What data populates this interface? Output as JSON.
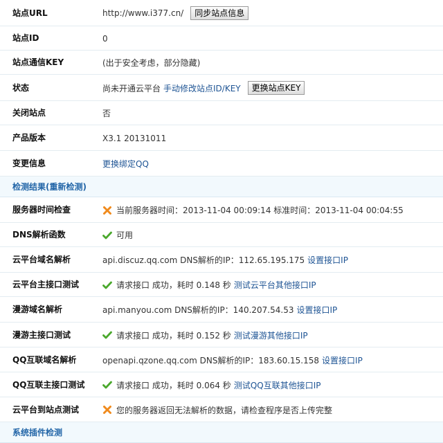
{
  "colors": {
    "link": "#1e5494",
    "section_bg": "#f2f9fd",
    "section_text": "#2366a8",
    "ok": "#4aa82c",
    "err": "#f08a1c"
  },
  "site": {
    "url_label": "站点URL",
    "url_value": "http://www.i377.cn/",
    "url_button": "同步站点信息",
    "id_label": "站点ID",
    "id_value": "0",
    "key_label": "站点通信KEY",
    "key_value": "(出于安全考虑，部分隐藏)",
    "status_label": "状态",
    "status_value": "尚未开通云平台",
    "status_link": "手动修改站点ID/KEY",
    "status_button": "更换站点KEY",
    "close_label": "关闭站点",
    "close_value": "否",
    "version_label": "产品版本",
    "version_value": "X3.1 20131011",
    "change_label": "变更信息",
    "change_link": "更换绑定QQ"
  },
  "check": {
    "section_title": "检测结果(重新检测)",
    "rows": [
      {
        "label": "服务器时间检查",
        "icon": "error-x-icon",
        "text": "当前服务器时间：2013-11-04 00:09:14 标准时间：2013-11-04 00:04:55",
        "link": ""
      },
      {
        "label": "DNS解析函数",
        "icon": "success-check-icon",
        "text": "可用",
        "link": ""
      },
      {
        "label": "云平台域名解析",
        "icon": "",
        "text": "api.discuz.qq.com DNS解析的IP：112.65.195.175",
        "link": "设置接口IP"
      },
      {
        "label": "云平台主接口测试",
        "icon": "success-check-icon",
        "text": "请求接口 成功，耗时 0.148 秒",
        "link": "测试云平台其他接口IP"
      },
      {
        "label": "漫游域名解析",
        "icon": "",
        "text": "api.manyou.com DNS解析的IP：140.207.54.53",
        "link": "设置接口IP"
      },
      {
        "label": "漫游主接口测试",
        "icon": "success-check-icon",
        "text": "请求接口 成功，耗时 0.152 秒",
        "link": "测试漫游其他接口IP"
      },
      {
        "label": "QQ互联域名解析",
        "icon": "",
        "text": "openapi.qzone.qq.com DNS解析的IP：183.60.15.158",
        "link": "设置接口IP"
      },
      {
        "label": "QQ互联主接口测试",
        "icon": "success-check-icon",
        "text": "请求接口 成功，耗时 0.064 秒",
        "link": "测试QQ互联其他接口IP"
      },
      {
        "label": "云平台到站点测试",
        "icon": "error-x-icon",
        "text": "您的服务器返回无法解析的数据，请检查程序是否上传完整",
        "link": ""
      }
    ]
  },
  "plugins": {
    "section_title": "系统插件检测"
  }
}
